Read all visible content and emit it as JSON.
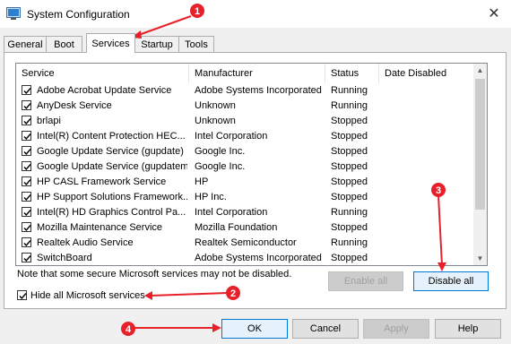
{
  "window": {
    "title": "System Configuration",
    "close_glyph": "✕"
  },
  "tabs": [
    {
      "label": "General",
      "active": false
    },
    {
      "label": "Boot",
      "active": false
    },
    {
      "label": "Services",
      "active": true
    },
    {
      "label": "Startup",
      "active": false
    },
    {
      "label": "Tools",
      "active": false
    }
  ],
  "services_list": {
    "columns": [
      "Service",
      "Manufacturer",
      "Status",
      "Date Disabled"
    ],
    "rows": [
      {
        "service": "Adobe Acrobat Update Service",
        "manufacturer": "Adobe Systems Incorporated",
        "status": "Running",
        "checked": true
      },
      {
        "service": "AnyDesk Service",
        "manufacturer": "Unknown",
        "status": "Running",
        "checked": true
      },
      {
        "service": "brlapi",
        "manufacturer": "Unknown",
        "status": "Stopped",
        "checked": true
      },
      {
        "service": "Intel(R) Content Protection HEC...",
        "manufacturer": "Intel Corporation",
        "status": "Stopped",
        "checked": true
      },
      {
        "service": "Google Update Service (gupdate)",
        "manufacturer": "Google Inc.",
        "status": "Stopped",
        "checked": true
      },
      {
        "service": "Google Update Service (gupdatem)",
        "manufacturer": "Google Inc.",
        "status": "Stopped",
        "checked": true
      },
      {
        "service": "HP CASL Framework Service",
        "manufacturer": "HP",
        "status": "Stopped",
        "checked": true
      },
      {
        "service": "HP Support Solutions Framework...",
        "manufacturer": "HP Inc.",
        "status": "Stopped",
        "checked": true
      },
      {
        "service": "Intel(R) HD Graphics Control Pa...",
        "manufacturer": "Intel Corporation",
        "status": "Running",
        "checked": true
      },
      {
        "service": "Mozilla Maintenance Service",
        "manufacturer": "Mozilla Foundation",
        "status": "Stopped",
        "checked": true
      },
      {
        "service": "Realtek Audio Service",
        "manufacturer": "Realtek Semiconductor",
        "status": "Running",
        "checked": true
      },
      {
        "service": "SwitchBoard",
        "manufacturer": "Adobe Systems Incorporated",
        "status": "Stopped",
        "checked": true
      }
    ]
  },
  "note": "Note that some secure Microsoft services may not be disabled.",
  "enable_all_label": "Enable all",
  "disable_all_label": "Disable all",
  "hide_microsoft": {
    "label": "Hide all Microsoft services",
    "checked": true
  },
  "footer_buttons": {
    "ok": "OK",
    "cancel": "Cancel",
    "apply": "Apply",
    "help": "Help"
  },
  "annotations": {
    "color": "#e8202a",
    "markers": [
      "1",
      "2",
      "3",
      "4"
    ]
  }
}
